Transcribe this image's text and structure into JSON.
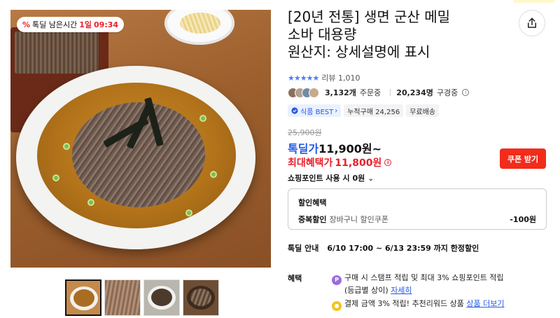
{
  "badge": {
    "prefix": "톡딜 남은시간",
    "days": "1일",
    "time": "09:34"
  },
  "product": {
    "title_line1": "[20년 전통] 생면 군산 메밀",
    "title_line2": "소바 대용량",
    "title_line3": "원산지: 상세설명에 표시"
  },
  "rating": {
    "stars": "★★★★★",
    "review_text": "리뷰 1,010"
  },
  "stats": {
    "orders_count": "3,132개",
    "orders_label": "주문중",
    "views_count": "20,234명",
    "views_label": "구경중"
  },
  "tags": {
    "best": "식품 BEST",
    "cumulative": "누적구매 24,256",
    "free_ship": "무료배송"
  },
  "price": {
    "original": "25,900원",
    "deal_label": "톡딜가",
    "deal_value": "11,900원~",
    "max_benefit_label": "최대혜택가",
    "max_benefit_value": "11,800원"
  },
  "coupon_button": "쿠폰 받기",
  "point_use": "쇼핑포인트 사용 시 0원",
  "discount": {
    "header": "할인혜택",
    "row_title": "중복할인",
    "row_sub": "장바구니 할인쿠폰",
    "row_amount": "-100원"
  },
  "deal_guide": {
    "label": "톡딜 안내",
    "period": "6/10 17:00 ~ 6/13 23:59 까지 한정할인"
  },
  "benefits": {
    "label": "혜택",
    "item1_line1": "구매 시 스탬프 적립 및 최대 3% 쇼핑포인트 적립",
    "item1_line2": "(등급별 상이)",
    "item1_link": "자세히",
    "item2_text": "결제 금액 3% 적립! 추천리워드 상품",
    "item2_link": "상품 더보기"
  },
  "icons": {
    "share": "share-icon",
    "info": "info-icon",
    "chevron": "chevron-down-icon",
    "percent": "percent-icon",
    "point_p": "point-p-icon",
    "coin": "coin-icon"
  },
  "colors": {
    "accent_blue": "#2459e8",
    "accent_red": "#e8212e",
    "coupon_red": "#f22b1a"
  }
}
